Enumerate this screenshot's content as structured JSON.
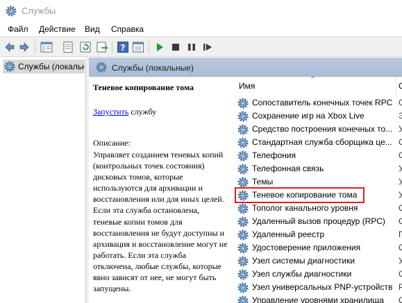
{
  "window": {
    "title": "Службы",
    "icon": "gear-icon"
  },
  "menu": [
    "Файл",
    "Действие",
    "Вид",
    "Справка"
  ],
  "toolbar": {
    "buttons": [
      "back-icon",
      "forward-icon",
      "show-tree-icon",
      "properties-icon",
      "refresh-icon",
      "export-icon",
      "help-icon",
      "console-icon",
      "start-icon",
      "stop-icon",
      "pause-icon",
      "restart-icon"
    ]
  },
  "tree": {
    "root_label": "Службы (локальные)"
  },
  "pane": {
    "header": "Службы (локальные)",
    "selected_service": "Теневое копирование тома",
    "start_link": "Запустить",
    "start_rest": " службу",
    "desc_label": "Описание:",
    "desc_text": "Управляет созданием теневых копий (контрольных точек состояния) дисковых томов, которые используются для архивации и восстановления или для иных целей. Если эта служба остановлена, теневые копии томов для восстановления не будут доступны и архивация и восстановление могут не работать. Если эта служба отключена, любые службы, которые явно зависят от нее, не могут быть запущены."
  },
  "list": {
    "sort_arrow": "^",
    "col_name": "Имя",
    "col_next": "О",
    "rows": [
      {
        "name": "Сопоставитель конечных точек RPC",
        "col2": "С"
      },
      {
        "name": "Сохранение игр на Xbox Live",
        "col2": "Э"
      },
      {
        "name": "Средство построения конечных то...",
        "col2": "У"
      },
      {
        "name": "Стандартная служба сборщика це...",
        "col2": "С"
      },
      {
        "name": "Телефония",
        "col2": "О"
      },
      {
        "name": "Телефонная связь",
        "col2": "У"
      },
      {
        "name": "Темы",
        "col2": "У"
      },
      {
        "name": "Теневое копирование тома",
        "col2": "У",
        "selected": true
      },
      {
        "name": "Тополог канального уровня",
        "col2": "С"
      },
      {
        "name": "Удаленный вызов процедур (RPC)",
        "col2": "С"
      },
      {
        "name": "Удаленный реестр",
        "col2": "П"
      },
      {
        "name": "Удостоверение приложения",
        "col2": "О"
      },
      {
        "name": "Узел системы диагностики",
        "col2": "У"
      },
      {
        "name": "Узел службы диагностики",
        "col2": "С"
      },
      {
        "name": "Узел универсальных PNP-устройств",
        "col2": "Р"
      },
      {
        "name": "Управление уровнями хранилища",
        "col2": "О"
      }
    ]
  },
  "colors": {
    "highlight": "#e01b1b",
    "link": "#0000ee",
    "header": "#b9c9dd"
  }
}
